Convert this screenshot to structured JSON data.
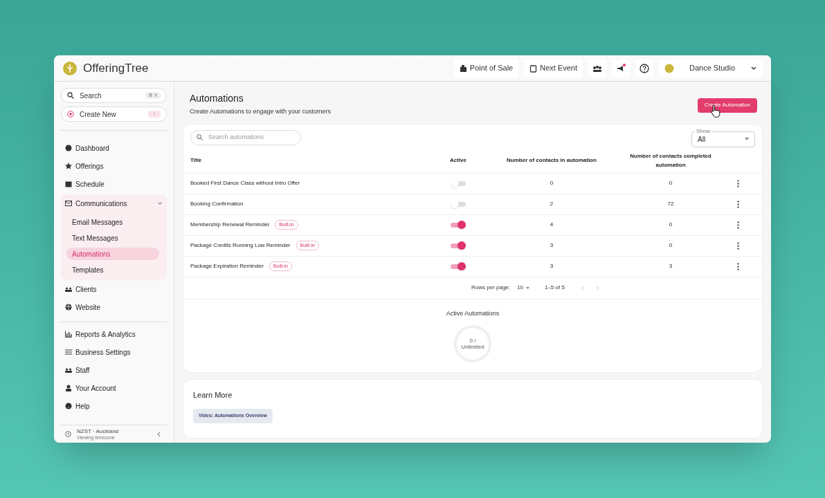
{
  "header": {
    "brand": "OfferingTree",
    "actions": [
      {
        "label": "Point of Sale"
      },
      {
        "label": "Next Event"
      }
    ],
    "account": "Dance Studio"
  },
  "sidebar": {
    "search": {
      "placeholder": "Search",
      "shortcut": "⌘ K"
    },
    "create_new": {
      "label": "Create New",
      "shortcut": "/"
    },
    "groups": [
      [
        {
          "label": "Dashboard",
          "selected": false
        },
        {
          "label": "Offerings",
          "selected": false
        },
        {
          "label": "Schedule",
          "selected": false
        },
        {
          "label": "Communications",
          "selected": false,
          "expanded": true,
          "children": [
            {
              "label": "Email Messages",
              "selected": false
            },
            {
              "label": "Text Messages",
              "selected": false
            },
            {
              "label": "Automations",
              "selected": true
            },
            {
              "label": "Templates",
              "selected": false
            }
          ]
        },
        {
          "label": "Clients",
          "selected": false
        },
        {
          "label": "Website",
          "selected": false
        }
      ],
      [
        {
          "label": "Reports & Analytics",
          "selected": false
        },
        {
          "label": "Business Settings",
          "selected": false
        },
        {
          "label": "Staff",
          "selected": false
        },
        {
          "label": "Your Account",
          "selected": false
        },
        {
          "label": "Help",
          "selected": false
        }
      ]
    ],
    "timezone": {
      "name": "NZST · Auckland",
      "caption": "Viewing timezone"
    }
  },
  "main": {
    "title": "Automations",
    "subtitle": "Create Automations to engage with your customers",
    "create_button": "Create Automation",
    "table": {
      "search": {
        "placeholder": "Search automations"
      },
      "show": {
        "label": "Show",
        "value": "All"
      },
      "columns": [
        "Title",
        "Active",
        "Number of contacts in automation",
        "Number of contacts completed automation"
      ],
      "rows": [
        {
          "title": "Booked First Dance Class without Intro Offer",
          "active": false,
          "in_automation": "0",
          "completed": "0"
        },
        {
          "title": "Booking Confirmation",
          "active": false,
          "in_automation": "2",
          "completed": "72"
        },
        {
          "title": "Membership Renewal Reminder",
          "badge": "Built-in",
          "active": true,
          "in_automation": "4",
          "completed": "0"
        },
        {
          "title": "Package Credits Running Low Reminder",
          "badge": "Built-in",
          "active": true,
          "in_automation": "3",
          "completed": "0"
        },
        {
          "title": "Package Expiration Reminder",
          "badge": "Built-in",
          "active": true,
          "in_automation": "3",
          "completed": "3"
        }
      ],
      "pagination": {
        "rows_per_page_label": "Rows per page:",
        "rows_per_page": "10",
        "range": "1–5 of 5"
      }
    },
    "stats": {
      "title": "Active Automations",
      "value": "0 /",
      "limit": "Unlimited"
    },
    "learn_more": {
      "title": "Learn More",
      "links": [
        "Video: Automations Overview"
      ]
    }
  }
}
